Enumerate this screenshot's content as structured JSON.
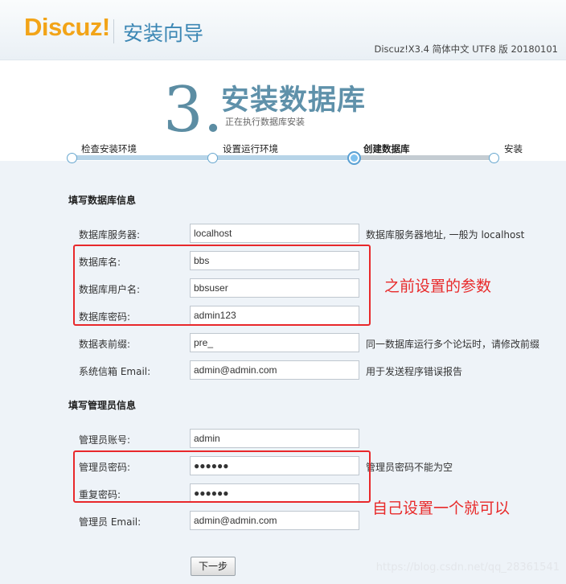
{
  "header": {
    "logo_text": "Discuz!",
    "wizard_title": "安装向导",
    "version": "Discuz!X3.4 简体中文 UTF8 版 20180101"
  },
  "step": {
    "number": "3.",
    "name": "安装数据库",
    "desc": "正在执行数据库安装"
  },
  "progress": {
    "steps": [
      "检查安装环境",
      "设置运行环境",
      "创建数据库",
      "安装"
    ],
    "current_index": 2
  },
  "db_section": {
    "title": "填写数据库信息",
    "fields": [
      {
        "label": "数据库服务器:",
        "value": "localhost",
        "hint": "数据库服务器地址, 一般为 localhost"
      },
      {
        "label": "数据库名:",
        "value": "bbs",
        "hint": ""
      },
      {
        "label": "数据库用户名:",
        "value": "bbsuser",
        "hint": ""
      },
      {
        "label": "数据库密码:",
        "value": "admin123",
        "hint": ""
      },
      {
        "label": "数据表前缀:",
        "value": "pre_",
        "hint": "同一数据库运行多个论坛时，请修改前缀"
      },
      {
        "label": "系统信箱 Email:",
        "value": "admin@admin.com",
        "hint": "用于发送程序错误报告"
      }
    ]
  },
  "admin_section": {
    "title": "填写管理员信息",
    "fields": [
      {
        "label": "管理员账号:",
        "value": "admin",
        "hint": ""
      },
      {
        "label": "管理员密码:",
        "value": "●●●●●●",
        "hint": "管理员密码不能为空"
      },
      {
        "label": "重复密码:",
        "value": "●●●●●●",
        "hint": ""
      },
      {
        "label": "管理员 Email:",
        "value": "admin@admin.com",
        "hint": ""
      }
    ]
  },
  "annotations": {
    "db_note": "之前设置的参数",
    "admin_note": "自己设置一个就可以"
  },
  "next_button": "下一步",
  "watermark": "https://blog.csdn.net/qq_28361541",
  "colors": {
    "logo": "#f2a418",
    "title": "#3c87b4",
    "annotation": "#e8282b"
  }
}
